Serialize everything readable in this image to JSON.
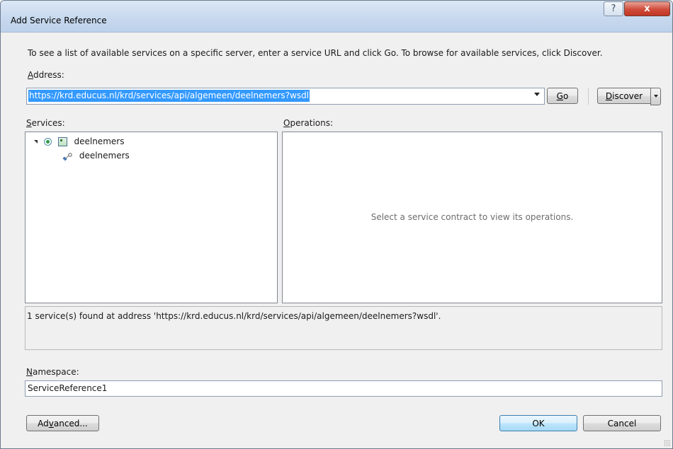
{
  "window": {
    "title": "Add Service Reference",
    "help_glyph": "?",
    "close_glyph": "x"
  },
  "instructions": "To see a list of available services on a specific server, enter a service URL and click Go. To browse for available services, click Discover.",
  "address": {
    "label_prefix": "A",
    "label_rest": "ddress:",
    "value": "https://krd.educus.nl/krd/services/api/algemeen/deelnemers?wsdl"
  },
  "buttons": {
    "go_mnemonic": "G",
    "go_rest": "o",
    "discover_mnemonic": "D",
    "discover_rest": "iscover",
    "advanced_prefix": "Ad",
    "advanced_mnemonic": "v",
    "advanced_rest": "anced...",
    "ok": "OK",
    "cancel": "Cancel"
  },
  "services": {
    "label_prefix": "S",
    "label_rest": "ervices:",
    "tree": [
      {
        "label": "deelnemers",
        "level": 0,
        "icon": "service-icon"
      },
      {
        "label": "deelnemers",
        "level": 1,
        "icon": "contract-icon"
      }
    ]
  },
  "operations": {
    "label_prefix": "O",
    "label_rest": "perations:",
    "placeholder": "Select a service contract to view its operations."
  },
  "status": "1 service(s) found at address 'https://krd.educus.nl/krd/services/api/algemeen/deelnemers?wsdl'.",
  "namespace": {
    "label_prefix": "N",
    "label_rest": "amespace:",
    "value": "ServiceReference1"
  }
}
